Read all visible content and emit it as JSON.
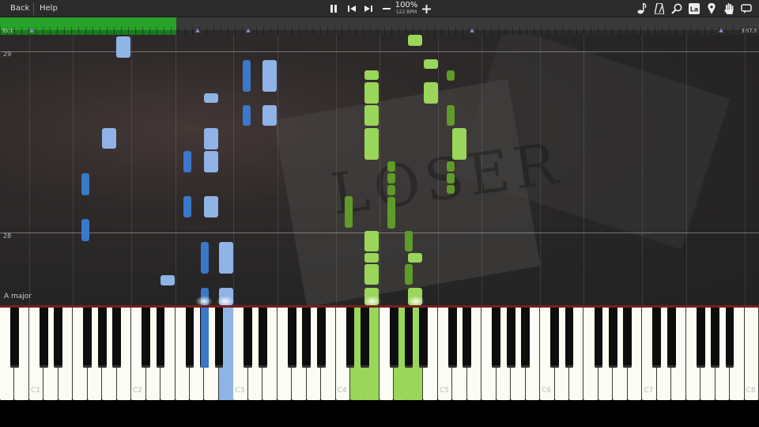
{
  "toolbar": {
    "back_label": "Back",
    "help_label": "Help",
    "speed_percent": "100%",
    "bpm": "122 BPM",
    "icons": [
      "pause-icon",
      "skip-back-icon",
      "skip-forward-icon",
      "minus-icon",
      "plus-icon",
      "note-icon",
      "metronome-icon",
      "magnifier-icon",
      "label-icon",
      "location-pin-icon",
      "hand-icon",
      "speech-bubble-icon"
    ],
    "label_icon_text": "La"
  },
  "timeline": {
    "current_time": "55.1",
    "total_time": "3:57.3",
    "progress": 0.232,
    "markers": [
      0.042,
      0.26,
      0.327,
      0.622,
      0.95
    ]
  },
  "roll": {
    "measures": [
      "29",
      "28"
    ],
    "key_signature": "A major"
  },
  "keyboard": {
    "octave_labels": [
      "C1",
      "C2",
      "C3",
      "C4",
      "C5",
      "C6",
      "C7",
      "C8"
    ],
    "pressed_left_hand": [
      "B2"
    ],
    "pressed_right_hand": [
      "D4",
      "G4"
    ]
  },
  "colors": {
    "left_hand_light": "#8fb3e6",
    "left_hand_dark": "#3a78c9",
    "right_hand_light": "#9ad65a",
    "right_hand_dark": "#5f9a2a",
    "progress": "#27a22a"
  }
}
